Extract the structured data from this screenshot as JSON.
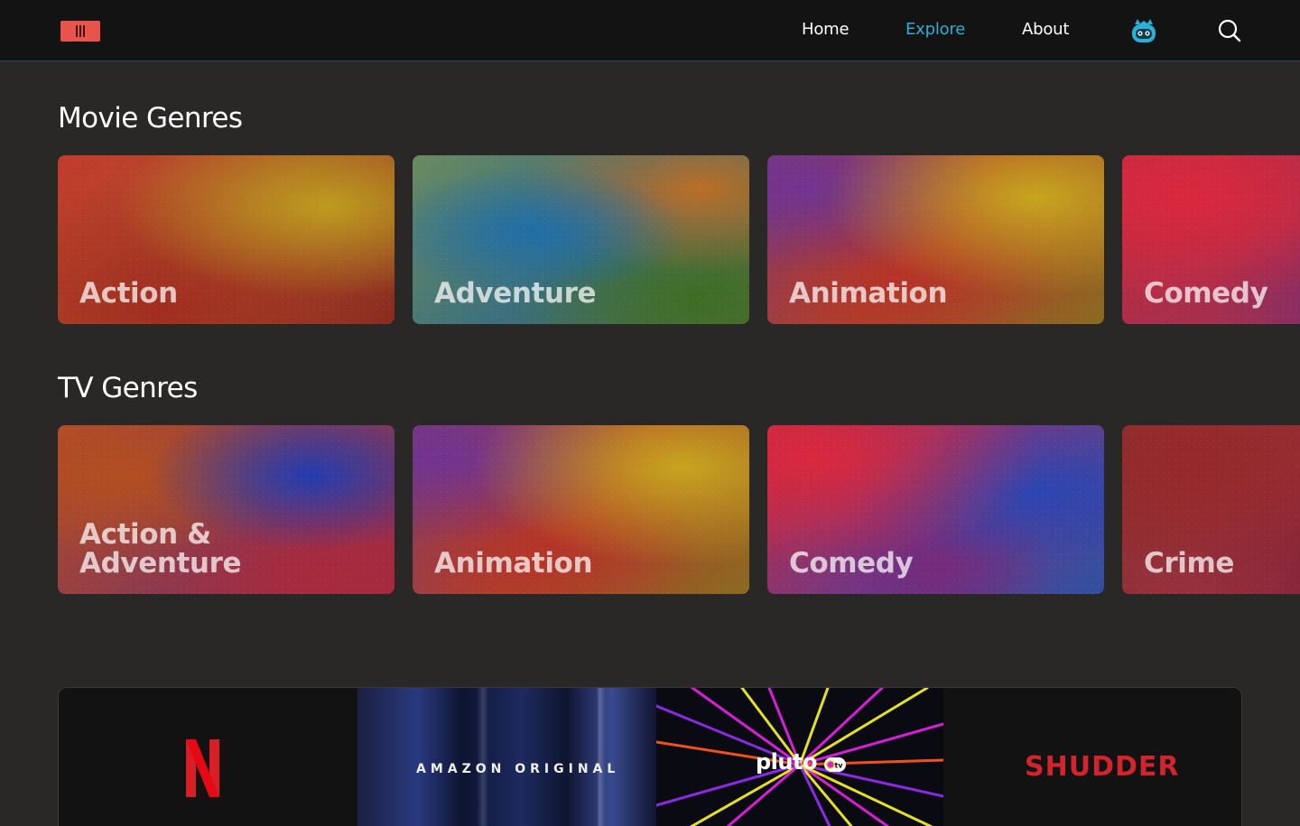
{
  "nav": {
    "home": "Home",
    "explore": "Explore",
    "about": "About"
  },
  "colors": {
    "accent": "#2ab0d4",
    "logo": "#e8534a",
    "header_bg": "#131313",
    "page_bg": "#2a2727"
  },
  "movie_genres": {
    "title": "Movie Genres",
    "items": [
      {
        "label": "Action"
      },
      {
        "label": "Adventure"
      },
      {
        "label": "Animation"
      },
      {
        "label": "Comedy"
      }
    ]
  },
  "tv_genres": {
    "title": "TV Genres",
    "items": [
      {
        "label": "Action & Adventure"
      },
      {
        "label": "Animation"
      },
      {
        "label": "Comedy"
      },
      {
        "label": "Crime"
      }
    ]
  },
  "providers": {
    "amazon_label": "AMAZON ORIGINAL",
    "pluto_label": "pluto",
    "pluto_badge": "tv",
    "shudder_label": "SHUDDER"
  }
}
